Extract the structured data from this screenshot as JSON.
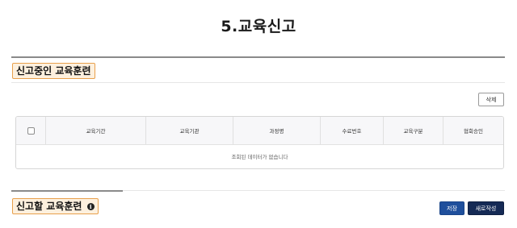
{
  "page": {
    "title": "5.교육신고"
  },
  "section_current": {
    "label": "신고중인 교육훈련",
    "delete_label": "삭제",
    "table": {
      "columns": [
        "교육기간",
        "교육기관",
        "과정명",
        "수료번호",
        "교육구분",
        "협회승인"
      ],
      "empty_message": "조회된 데이터가 없습니다"
    }
  },
  "section_new": {
    "label": "신고할 교육훈련",
    "info_glyph": "i",
    "save_label": "저장",
    "new_label": "새로작성"
  },
  "colors": {
    "label_bg": "#fdf0de",
    "label_border": "#e8a04c",
    "save_button": "#1f4f9c",
    "new_button": "#152a55"
  }
}
